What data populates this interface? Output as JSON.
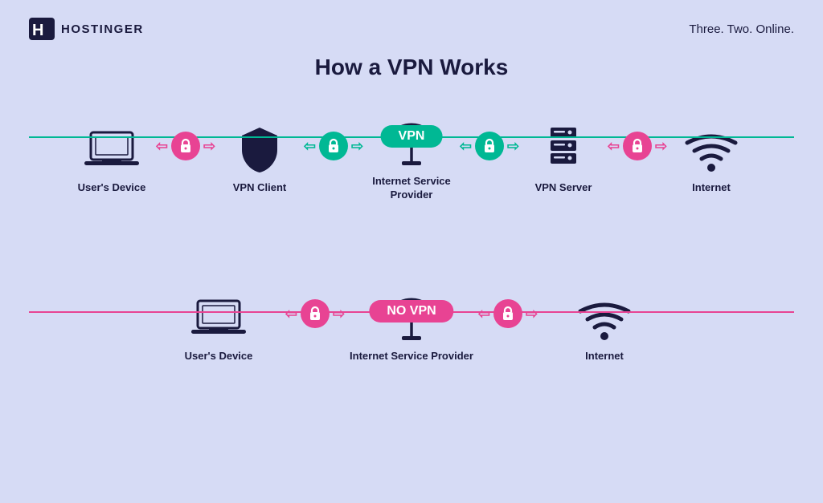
{
  "header": {
    "logo_text": "HOSTINGER",
    "tagline": "Three. Two. Online."
  },
  "page": {
    "title": "How a VPN Works"
  },
  "vpn_section": {
    "badge": "VPN",
    "items": [
      {
        "label": "User's Device"
      },
      {
        "label": "VPN Client"
      },
      {
        "label": "Internet Service Provider"
      },
      {
        "label": "VPN Server"
      },
      {
        "label": "Internet"
      }
    ]
  },
  "novpn_section": {
    "badge": "NO VPN",
    "items": [
      {
        "label": "User's Device"
      },
      {
        "label": "Internet Service Provider"
      },
      {
        "label": "Internet"
      }
    ]
  },
  "colors": {
    "teal": "#00b894",
    "pink": "#e84393",
    "dark": "#1a1a3e",
    "bg": "#d6dbf5"
  }
}
